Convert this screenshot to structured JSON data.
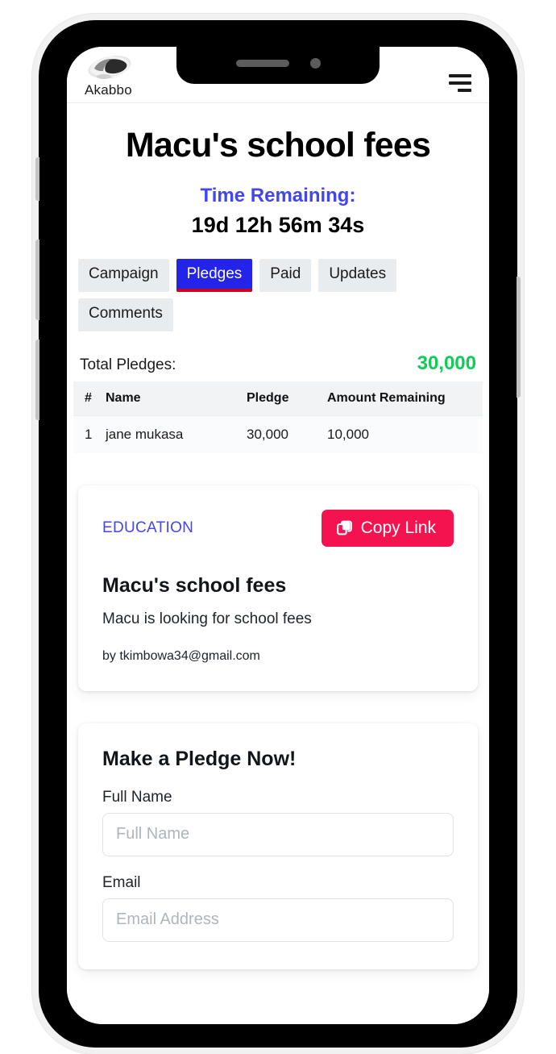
{
  "header": {
    "brand_name": "Akabbo",
    "logo_icon": "akabbo-basket-logo",
    "menu_icon": "hamburger-menu-icon"
  },
  "campaign": {
    "title": "Macu's school fees",
    "time_remaining_label": "Time Remaining:",
    "time_remaining_value": "19d 12h 56m 34s"
  },
  "tabs": [
    {
      "label": "Campaign",
      "active": false
    },
    {
      "label": "Pledges",
      "active": true
    },
    {
      "label": "Paid",
      "active": false
    },
    {
      "label": "Updates",
      "active": false
    },
    {
      "label": "Comments",
      "active": false
    }
  ],
  "pledges": {
    "total_label": "Total Pledges:",
    "total_value": "30,000",
    "columns": [
      "#",
      "Name",
      "Pledge",
      "Amount Remaining"
    ],
    "rows": [
      {
        "num": "1",
        "name": "jane mukasa",
        "pledge": "30,000",
        "remaining": "10,000"
      }
    ]
  },
  "campaign_card": {
    "category": "EDUCATION",
    "copy_link_label": "Copy Link",
    "copy_icon": "copy-icon",
    "title": "Macu's school fees",
    "description": "Macu is looking for school fees",
    "author": "by tkimbowa34@gmail.com"
  },
  "pledge_form": {
    "title": "Make a Pledge Now!",
    "fields": [
      {
        "label": "Full Name",
        "value": "",
        "placeholder": "Full Name"
      },
      {
        "label": "Email",
        "value": "",
        "placeholder": "Email Address"
      }
    ]
  },
  "colors": {
    "accent_blue": "#4346f0",
    "tab_active_bg": "#2323ea",
    "tab_active_underline": "#d0021b",
    "total_green": "#0fcc57",
    "copy_link_red": "#f4134f"
  }
}
